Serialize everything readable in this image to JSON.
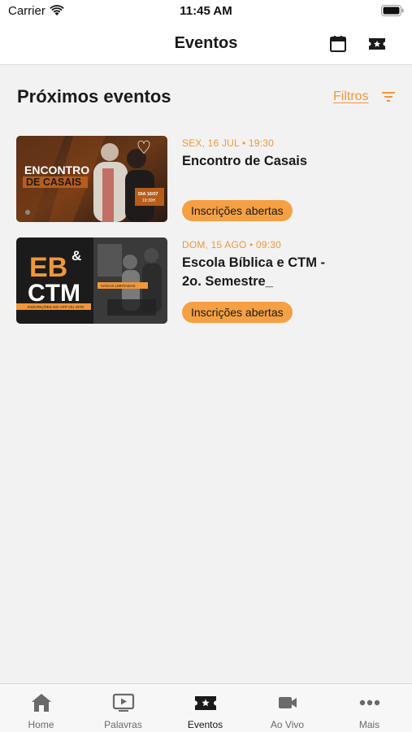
{
  "status_bar": {
    "carrier": "Carrier",
    "time": "11:45 AM"
  },
  "nav": {
    "title": "Eventos",
    "calendar_icon": "calendar-icon",
    "ticket_icon": "ticket-icon"
  },
  "section": {
    "title": "Próximos eventos",
    "filter_label": "Filtros"
  },
  "events": [
    {
      "date": "SEX, 16 JUL • 19:30",
      "title": "Encontro de Casais",
      "badge": "Inscrições abertas",
      "thumb": {
        "line1": "ENCONTRO",
        "line2": "DE CASAIS",
        "tag": "DIA 16/07",
        "tag_time": "19:30H"
      }
    },
    {
      "date": "DOM, 15 AGO • 09:30",
      "title": "Escola Bíblica e CTM - 2o. Semestre_",
      "badge": "Inscrições abertas",
      "thumb": {
        "line1": "EB",
        "amp": "&",
        "line2": "CTM",
        "strip_left": "INSCRIÇÕES NO APP OU SITE",
        "strip_right": "VAGAS LIMITADAS"
      }
    }
  ],
  "tabs": [
    {
      "label": "Home",
      "icon": "home-icon"
    },
    {
      "label": "Palavras",
      "icon": "play-screen-icon"
    },
    {
      "label": "Eventos",
      "icon": "ticket-icon",
      "active": true
    },
    {
      "label": "Ao Vivo",
      "icon": "video-camera-icon"
    },
    {
      "label": "Mais",
      "icon": "more-dots-icon"
    }
  ],
  "colors": {
    "accent": "#f0973a",
    "badge": "#f4a043",
    "background": "#f2f2f2",
    "text": "#1a1a1a"
  }
}
